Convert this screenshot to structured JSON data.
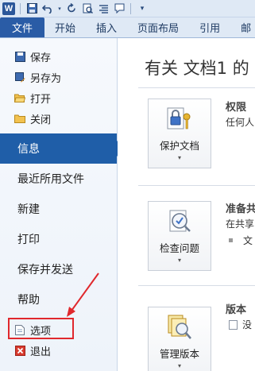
{
  "qat": {
    "icons": [
      "word-logo",
      "save-icon",
      "undo-icon",
      "redo-icon",
      "print-preview-icon",
      "paragraph-icon",
      "comment-icon",
      "customize-icon"
    ],
    "logo_letter": "W"
  },
  "tabs": [
    "文件",
    "开始",
    "插入",
    "页面布局",
    "引用",
    "邮"
  ],
  "nav": {
    "small_top": [
      "保存",
      "另存为",
      "打开",
      "关闭"
    ],
    "big": [
      "信息",
      "最近所用文件",
      "新建",
      "打印",
      "保存并发送",
      "帮助"
    ],
    "small_bottom": [
      "选项",
      "退出"
    ],
    "active": "信息"
  },
  "content": {
    "title": "有关 文档1 的",
    "sections": [
      {
        "button": "保护文档",
        "heading": "权限",
        "text": "任何人"
      },
      {
        "button": "检查问题",
        "heading": "准备共",
        "text": "在共享",
        "bullet_text": "文"
      },
      {
        "button": "管理版本",
        "heading": "版本",
        "text": "没"
      }
    ]
  },
  "colors": {
    "accent": "#1f5ea8",
    "file_tab": "#2a5ca6",
    "annotation": "#e0282d"
  }
}
